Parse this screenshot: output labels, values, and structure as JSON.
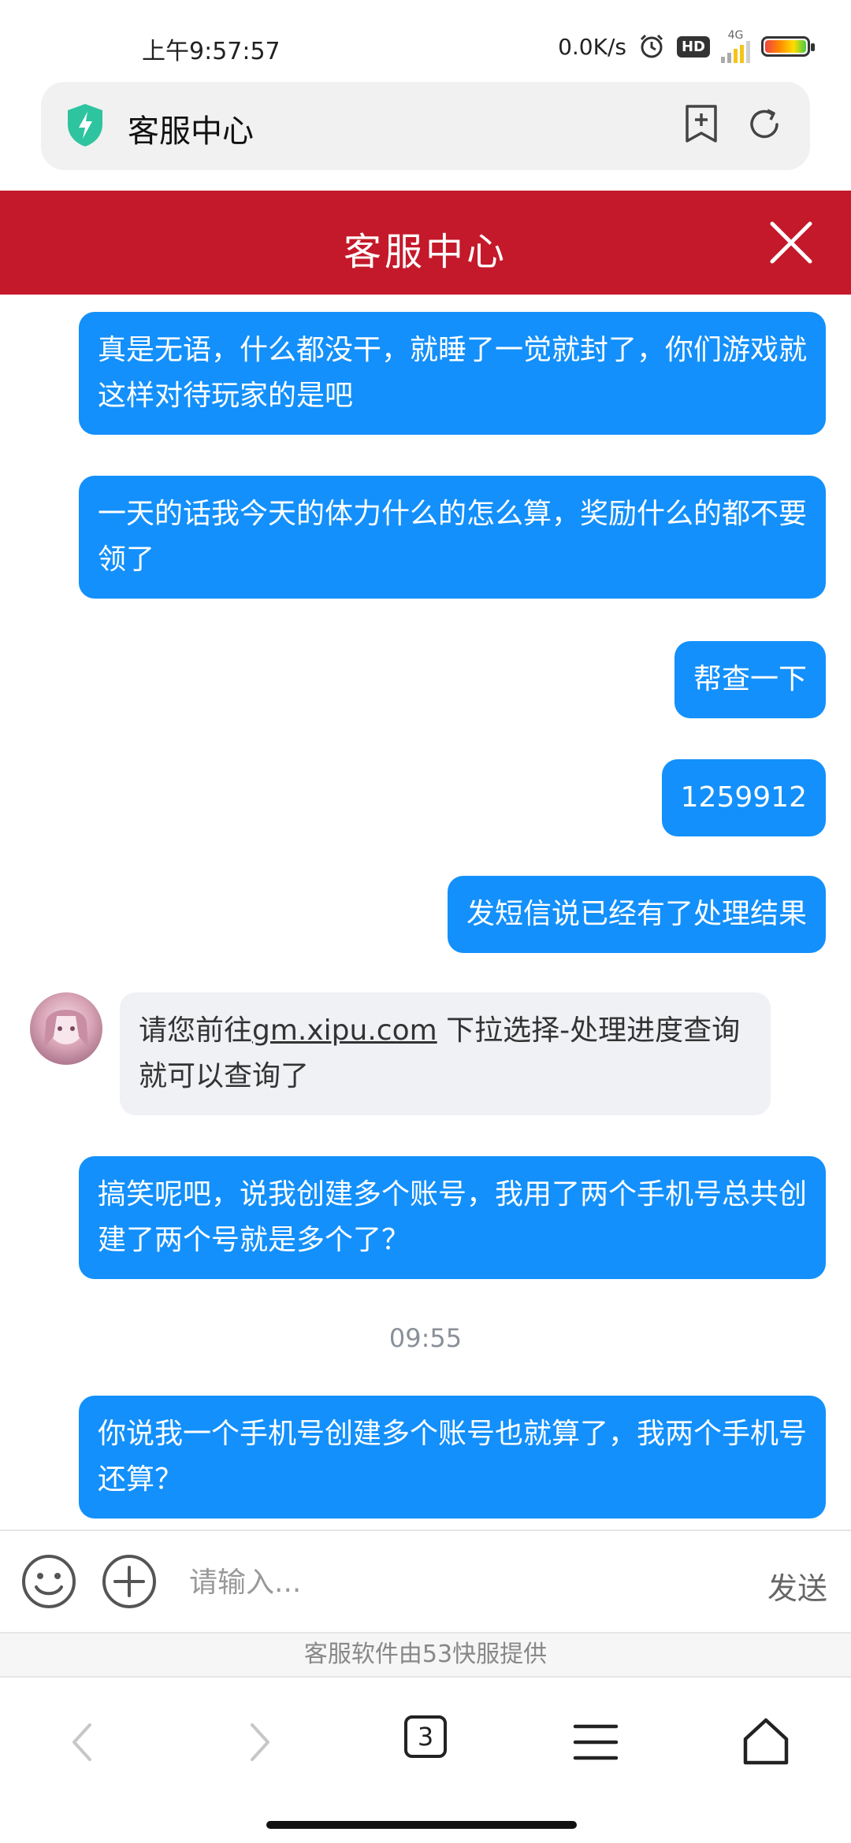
{
  "status_bar": {
    "time": "上午9:57:57",
    "net_speed": "0.0K/s",
    "hd": "HD",
    "network": "4G"
  },
  "address_bar": {
    "title": "客服中心"
  },
  "header": {
    "title": "客服中心"
  },
  "messages": [
    {
      "from": "user",
      "text": "真是无语，什么都没干，就睡了一觉就封了，你们游戏就这样对待玩家的是吧"
    },
    {
      "from": "user",
      "text": "一天的话我今天的体力什么的怎么算，奖励什么的都不要领了"
    },
    {
      "from": "user",
      "text": "帮查一下"
    },
    {
      "from": "user",
      "text": "1259912"
    },
    {
      "from": "user",
      "text": "发短信说已经有了处理结果"
    },
    {
      "from": "agent",
      "text_before": "请您前往",
      "link": "gm.xipu.com",
      "text_after": " 下拉选择-处理进度查询就可以查询了"
    },
    {
      "from": "user",
      "text": "搞笑呢吧，说我创建多个账号，我用了两个手机号总共创建了两个号就是多个了？"
    },
    {
      "from": "user",
      "text": "你说我一个手机号创建多个账号也就算了，我两个手机号还算？"
    }
  ],
  "timestamp": "09:55",
  "input": {
    "placeholder": "请输入...",
    "send_label": "发送"
  },
  "powered_by": "客服软件由53快服提供",
  "browser_nav": {
    "tab_count": "3"
  },
  "colors": {
    "header_red": "#c4192a",
    "user_bubble": "#1390fb",
    "agent_bubble": "#eff1f4"
  }
}
